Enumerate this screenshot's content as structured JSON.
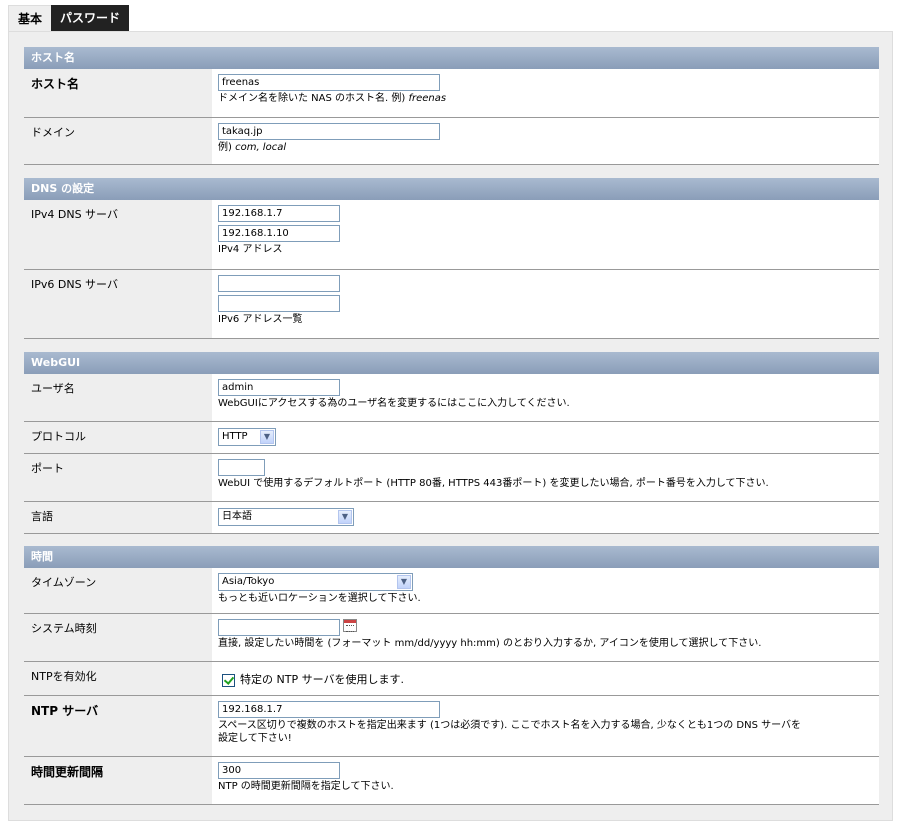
{
  "tabs": [
    {
      "label": "基本",
      "active": true
    },
    {
      "label": "パスワード",
      "active": false
    }
  ],
  "sections": {
    "hostname": {
      "title": "ホスト名",
      "host": {
        "label": "ホスト名",
        "value": "freenas",
        "hint": "ドメイン名を除いた NAS のホスト名.  例)",
        "example": "freenas"
      },
      "domain": {
        "label": "ドメイン",
        "value": "takaq.jp",
        "hint": "例)",
        "example": "com, local"
      }
    },
    "dns": {
      "title": "DNS の設定",
      "ipv4": {
        "label": "IPv4 DNS サーバ",
        "values": [
          "192.168.1.7",
          "192.168.1.10"
        ],
        "hint": "IPv4 アドレス"
      },
      "ipv6": {
        "label": "IPv6 DNS サーバ",
        "values": [
          "",
          ""
        ],
        "hint": "IPv6 アドレス一覧"
      }
    },
    "webgui": {
      "title": "WebGUI",
      "username": {
        "label": "ユーザ名",
        "value": "admin",
        "hint": "WebGUIにアクセスする為のユーザ名を変更するにはここに入力してください."
      },
      "protocol": {
        "label": "プロトコル",
        "value": "HTTP"
      },
      "port": {
        "label": "ポート",
        "value": "",
        "hint": "WebUI で使用するデフォルトポート (HTTP 80番, HTTPS 443番ポート) を変更したい場合, ポート番号を入力して下さい."
      },
      "language": {
        "label": "言語",
        "value": "日本語"
      }
    },
    "time": {
      "title": "時間",
      "timezone": {
        "label": "タイムゾーン",
        "value": "Asia/Tokyo",
        "hint": "もっとも近いロケーションを選択して下さい."
      },
      "systime": {
        "label": "システム時刻",
        "value": "",
        "hint": "直接, 設定したい時間を (フォーマット mm/dd/yyyy hh:mm) のとおり入力するか, アイコンを使用して選択して下さい."
      },
      "ntp_enable": {
        "label": "NTPを有効化",
        "checkbox_label": "特定の NTP サーバを使用します.",
        "checked": true
      },
      "ntp_server": {
        "label": "NTP サーバ",
        "value": "192.168.1.7",
        "hint_line1": "スペース区切りで複数のホストを指定出来ます (1つは必須です). ここでホスト名を入力する場合, 少なくとも1つの DNS サーバを",
        "hint_line2": "設定して下さい!"
      },
      "update_interval": {
        "label": "時間更新間隔",
        "value": "300",
        "hint": "NTP の時間更新間隔を指定して下さい."
      }
    }
  }
}
